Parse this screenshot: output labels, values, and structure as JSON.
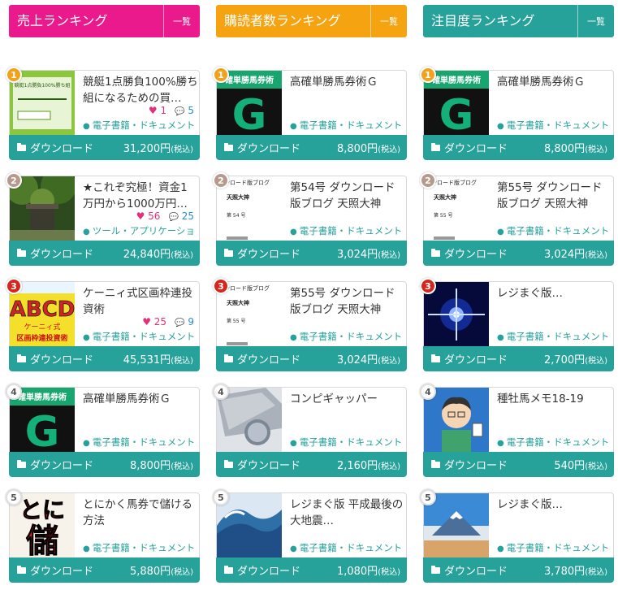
{
  "colors": {
    "sales": "#ea1a8d",
    "buyers": "#f5a311",
    "attention": "#27a29b",
    "download_bar": "#27a29b"
  },
  "common": {
    "more_label": "一覧",
    "download_label": "ダウンロード",
    "tax_label": "(税込)",
    "tag_icon": "tag-icon",
    "like_icon": "♥",
    "comment_icon": "💬"
  },
  "columns": [
    {
      "title": "売上ランキング",
      "items": [
        {
          "rank": "1",
          "title": "競艇1点勝負100%勝ち組になるための買…",
          "likes": "1",
          "comments": "5",
          "tag": "電子書籍・ドキュメント",
          "price": "31,200円",
          "thumb": "green-doc"
        },
        {
          "rank": "2",
          "title": "★これぞ究極！資金1万円から1000万円…",
          "likes": "56",
          "comments": "25",
          "tag": "ツール・アプリケーショ",
          "price": "24,840円",
          "thumb": "forest"
        },
        {
          "rank": "3",
          "title": "ケーニィ式区画枠連投資術",
          "likes": "25",
          "comments": "9",
          "tag": "電子書籍・ドキュメント",
          "price": "45,531円",
          "thumb": "abcd"
        },
        {
          "rank": "4",
          "title": "高確単勝馬券術Ｇ",
          "tag": "電子書籍・ドキュメント",
          "price": "8,800円",
          "thumb": "g-book"
        },
        {
          "rank": "5",
          "title": "とにかく馬券で儲ける方法",
          "tag": "電子書籍・ドキュメント",
          "price": "5,880円",
          "thumb": "tonimou"
        }
      ]
    },
    {
      "title": "購読者数ランキング",
      "items": [
        {
          "rank": "1",
          "title": "高確単勝馬券術Ｇ",
          "tag": "電子書籍・ドキュメント",
          "price": "8,800円",
          "thumb": "g-book"
        },
        {
          "rank": "2",
          "title": "第54号 ダウンロード版ブログ 天照大神",
          "tag": "電子書籍・ドキュメント",
          "price": "3,024円",
          "thumb": "doc54"
        },
        {
          "rank": "3",
          "title": "第55号 ダウンロード版ブログ 天照大神",
          "tag": "電子書籍・ドキュメント",
          "price": "3,024円",
          "thumb": "doc55"
        },
        {
          "rank": "4",
          "title": "コンピギャッパー",
          "tag": "電子書籍・ドキュメント",
          "price": "2,160円",
          "thumb": "laptop"
        },
        {
          "rank": "5",
          "title": "レジまぐ版 平成最後の大地震…",
          "tag": "電子書籍・ドキュメント",
          "price": "1,080円",
          "thumb": "wave"
        }
      ]
    },
    {
      "title": "注目度ランキング",
      "items": [
        {
          "rank": "1",
          "title": "高確単勝馬券術Ｇ",
          "tag": "電子書籍・ドキュメント",
          "price": "8,800円",
          "thumb": "g-book"
        },
        {
          "rank": "2",
          "title": "第55号 ダウンロード版ブログ 天照大神",
          "tag": "電子書籍・ドキュメント",
          "price": "3,024円",
          "thumb": "doc55"
        },
        {
          "rank": "3",
          "title": "レジまぐ版…",
          "tag": "電子書籍・ドキュメント",
          "price": "2,700円",
          "thumb": "star"
        },
        {
          "rank": "4",
          "title": "種牡馬メモ18-19",
          "tag": "電子書籍・ドキュメント",
          "price": "540円",
          "thumb": "avatar"
        },
        {
          "rank": "5",
          "title": "レジまぐ版…",
          "tag": "電子書籍・ドキュメント",
          "price": "3,780円",
          "thumb": "fuji"
        }
      ]
    }
  ],
  "thumb_text": {
    "g_book_band": "確単勝馬券術",
    "g_book_letter": "G",
    "green_doc_heading": "競艇1点勝負100%勝ち組",
    "doc_header": "ウンロード版ブログ",
    "doc_author": "天照大神",
    "doc54_issue": "第 54 号",
    "doc55_issue": "第 55 号",
    "abcd_top": "ABCD",
    "abcd_mid": "ケーニィ式",
    "abcd_bottom": "区画枠連投資術",
    "tonimou_top": "とに",
    "tonimou_bottom": "儲"
  }
}
